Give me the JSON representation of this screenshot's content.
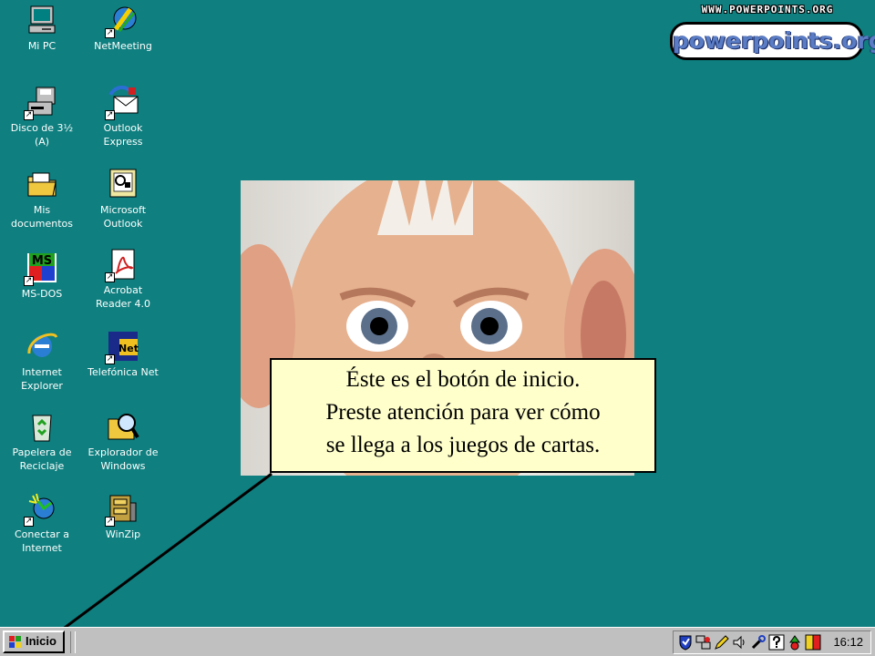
{
  "desktop": {
    "icons": [
      {
        "id": "mi-pc",
        "label": "Mi PC"
      },
      {
        "id": "netmeeting",
        "label": "NetMeeting"
      },
      {
        "id": "disco",
        "label": "Disco de 3½\n(A)"
      },
      {
        "id": "outlook-express",
        "label": "Outlook\nExpress"
      },
      {
        "id": "mis-documentos",
        "label": "Mis\ndocumentos"
      },
      {
        "id": "microsoft-outlook",
        "label": "Microsoft\nOutlook"
      },
      {
        "id": "ms-dos",
        "label": "MS-DOS"
      },
      {
        "id": "acrobat",
        "label": "Acrobat\nReader 4.0"
      },
      {
        "id": "internet-explorer",
        "label": "Internet\nExplorer"
      },
      {
        "id": "telefonica",
        "label": "Telefónica Net"
      },
      {
        "id": "papelera",
        "label": "Papelera de\nReciclaje"
      },
      {
        "id": "explorador",
        "label": "Explorador de\nWindows"
      },
      {
        "id": "conectar",
        "label": "Conectar a\nInternet"
      },
      {
        "id": "winzip",
        "label": "WinZip"
      }
    ],
    "icon_glyph_text": {
      "ms_dos": "MS",
      "telefonica": "Net"
    }
  },
  "logo": {
    "url_text": "WWW.POWERPOINTS.ORG",
    "name": "powerpoints.org"
  },
  "callout": {
    "lines": [
      "Éste es el botón de inicio.",
      "Preste atención para ver cómo",
      "se llega a los juegos de cartas."
    ]
  },
  "taskbar": {
    "start_label": "Inicio",
    "clock": "16:12",
    "tray_icons": [
      "shield-icon",
      "network-icon",
      "pencil-icon",
      "speaker-icon",
      "tool-icon",
      "question-icon",
      "recycle-icon",
      "za-icon"
    ]
  },
  "colors": {
    "desktop": "#0f7f7f",
    "taskbar": "#c0c0c0",
    "callout_bg": "#ffffcc"
  }
}
